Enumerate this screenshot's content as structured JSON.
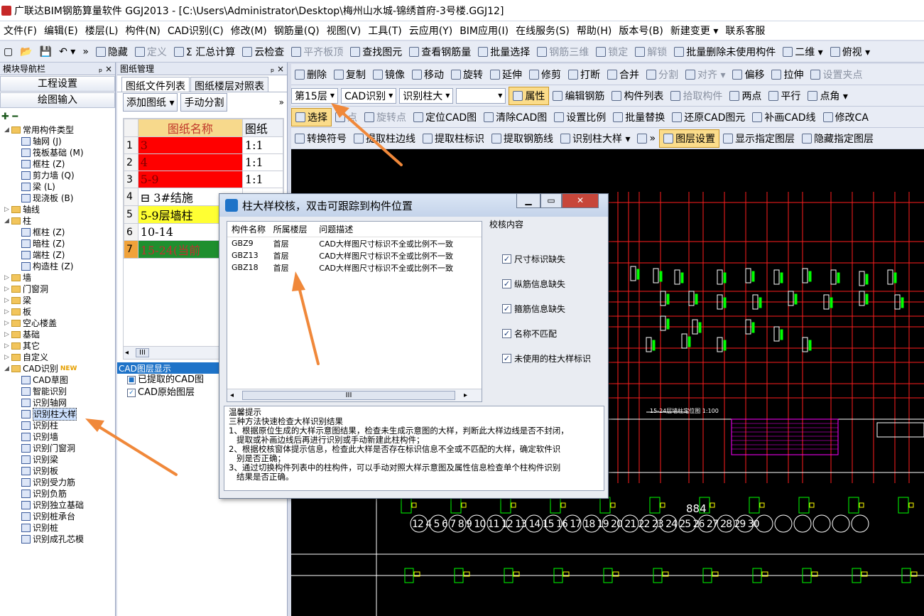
{
  "window": {
    "title": "广联达BIM钢筋算量软件 GGJ2013 - [C:\\Users\\Administrator\\Desktop\\梅州山水城-锦绣首府-3号楼.GGJ12]"
  },
  "menu": [
    "文件(F)",
    "编辑(E)",
    "楼层(L)",
    "构件(N)",
    "CAD识别(C)",
    "修改(M)",
    "钢筋量(Q)",
    "视图(V)",
    "工具(T)",
    "云应用(Y)",
    "BIM应用(I)",
    "在线服务(S)",
    "帮助(H)",
    "版本号(B)",
    "新建变更 ▾",
    "联系客服"
  ],
  "toolbar1": [
    {
      "label": "隐藏",
      "dis": false
    },
    {
      "label": "定义",
      "dis": true
    },
    {
      "label": "Σ 汇总计算",
      "dis": false
    },
    {
      "label": "云检查",
      "dis": false
    },
    {
      "label": "平齐板顶",
      "dis": true
    },
    {
      "label": "查找图元",
      "dis": false
    },
    {
      "label": "查看钢筋量",
      "dis": false
    },
    {
      "label": "批量选择",
      "dis": false
    },
    {
      "label": "钢筋三维",
      "dis": true
    },
    {
      "label": "锁定",
      "dis": true
    },
    {
      "label": "解锁",
      "dis": true
    },
    {
      "label": "批量删除未使用构件",
      "dis": false
    },
    {
      "label": "二维 ▾",
      "dis": false
    },
    {
      "label": "俯视 ▾",
      "dis": false
    }
  ],
  "nav": {
    "header": "模块导航栏",
    "pin": "ₚ",
    "close": "×",
    "btn_project": "工程设置",
    "btn_draw": "绘图输入",
    "tree": [
      {
        "t": "常用构件类型",
        "lvl": 0,
        "type": "folder",
        "open": true
      },
      {
        "t": "轴网 (J)",
        "lvl": 1,
        "type": "comp"
      },
      {
        "t": "筏板基础 (M)",
        "lvl": 1,
        "type": "comp"
      },
      {
        "t": "框柱 (Z)",
        "lvl": 1,
        "type": "comp"
      },
      {
        "t": "剪力墙 (Q)",
        "lvl": 1,
        "type": "comp"
      },
      {
        "t": "梁 (L)",
        "lvl": 1,
        "type": "comp"
      },
      {
        "t": "现浇板 (B)",
        "lvl": 1,
        "type": "comp"
      },
      {
        "t": "轴线",
        "lvl": 0,
        "type": "folder",
        "open": false
      },
      {
        "t": "柱",
        "lvl": 0,
        "type": "folder",
        "open": true
      },
      {
        "t": "框柱 (Z)",
        "lvl": 1,
        "type": "comp"
      },
      {
        "t": "暗柱 (Z)",
        "lvl": 1,
        "type": "comp"
      },
      {
        "t": "端柱 (Z)",
        "lvl": 1,
        "type": "comp"
      },
      {
        "t": "构造柱 (Z)",
        "lvl": 1,
        "type": "comp"
      },
      {
        "t": "墙",
        "lvl": 0,
        "type": "folder",
        "open": false
      },
      {
        "t": "门窗洞",
        "lvl": 0,
        "type": "folder",
        "open": false
      },
      {
        "t": "梁",
        "lvl": 0,
        "type": "folder",
        "open": false
      },
      {
        "t": "板",
        "lvl": 0,
        "type": "folder",
        "open": false
      },
      {
        "t": "空心楼盖",
        "lvl": 0,
        "type": "folder",
        "open": false
      },
      {
        "t": "基础",
        "lvl": 0,
        "type": "folder",
        "open": false
      },
      {
        "t": "其它",
        "lvl": 0,
        "type": "folder",
        "open": false
      },
      {
        "t": "自定义",
        "lvl": 0,
        "type": "folder",
        "open": false
      },
      {
        "t": "CAD识别",
        "lvl": 0,
        "type": "folder",
        "open": true,
        "new": "NEW"
      },
      {
        "t": "CAD草图",
        "lvl": 1,
        "type": "comp"
      },
      {
        "t": "智能识别",
        "lvl": 1,
        "type": "comp"
      },
      {
        "t": "识别轴网",
        "lvl": 1,
        "type": "comp"
      },
      {
        "t": "识别柱大样",
        "lvl": 1,
        "type": "comp",
        "sel": true
      },
      {
        "t": "识别柱",
        "lvl": 1,
        "type": "comp"
      },
      {
        "t": "识别墙",
        "lvl": 1,
        "type": "comp"
      },
      {
        "t": "识别门窗洞",
        "lvl": 1,
        "type": "comp"
      },
      {
        "t": "识别梁",
        "lvl": 1,
        "type": "comp"
      },
      {
        "t": "识别板",
        "lvl": 1,
        "type": "comp"
      },
      {
        "t": "识别受力筋",
        "lvl": 1,
        "type": "comp"
      },
      {
        "t": "识别负筋",
        "lvl": 1,
        "type": "comp"
      },
      {
        "t": "识别独立基础",
        "lvl": 1,
        "type": "comp"
      },
      {
        "t": "识别桩承台",
        "lvl": 1,
        "type": "comp"
      },
      {
        "t": "识别桩",
        "lvl": 1,
        "type": "comp"
      },
      {
        "t": "识别成孔芯模",
        "lvl": 1,
        "type": "comp"
      }
    ]
  },
  "drawings": {
    "header": "图纸管理",
    "tab1": "图纸文件列表",
    "tab2": "图纸楼层对照表",
    "btn_add": "添加图纸 ▾",
    "btn_split": "手动分割",
    "more": "»",
    "col_name": "图纸名称",
    "col_scale": "图纸",
    "rows": [
      {
        "n": "1",
        "name": "3",
        "scale": "1:1",
        "bg": "#ff0000"
      },
      {
        "n": "2",
        "name": "4",
        "scale": "1:1",
        "bg": "#ff0000"
      },
      {
        "n": "3",
        "name": "5-9",
        "scale": "1:1",
        "bg": "#ff0000"
      },
      {
        "n": "4",
        "name": "⊟ 3#结施",
        "scale": "",
        "bg": "#ffffff"
      },
      {
        "n": "5",
        "name": "5-9层墙柱",
        "scale": "",
        "bg": "#ffff33"
      },
      {
        "n": "6",
        "name": "10-14",
        "scale": "",
        "bg": "#ffffff"
      },
      {
        "n": "7",
        "name": "15-24(当前",
        "scale": "",
        "bg": "#1f8f2f"
      }
    ],
    "scroll_thumb": "III",
    "layer_header": "CAD图层显示",
    "layers": [
      "已提取的CAD图",
      "CAD原始图层"
    ]
  },
  "ribbon": {
    "row1": [
      "删除",
      "复制",
      "镜像",
      "移动",
      "旋转",
      "延伸",
      "修剪",
      "打断",
      "合并",
      "分割",
      "对齐 ▾",
      "偏移",
      "拉伸",
      "设置夹点"
    ],
    "row1_dis": [
      false,
      false,
      false,
      false,
      false,
      false,
      false,
      false,
      false,
      true,
      true,
      false,
      false,
      true
    ],
    "floor": "第15层",
    "cad_combo": "CAD识别",
    "col_combo": "识别柱大",
    "blank_combo": "",
    "row2": [
      "属性",
      "编辑钢筋",
      "构件列表",
      "拾取构件",
      "两点",
      "平行",
      "点角 ▾"
    ],
    "row3": [
      "选择",
      "点",
      "旋转点",
      "定位CAD图",
      "清除CAD图",
      "设置比例",
      "批量替换",
      "还原CAD图元",
      "补画CAD线",
      "修改CA"
    ],
    "row4": [
      "转换符号",
      "提取柱边线",
      "提取柱标识",
      "提取钢筋线",
      "识别柱大样 ▾",
      "»",
      "图层设置",
      "显示指定图层",
      "隐藏指定图层"
    ]
  },
  "dialog": {
    "title": "柱大样校核，双击可跟踪到构件位置",
    "min": "▁",
    "max": "▭",
    "close": "✕",
    "cols": [
      "构件名称",
      "所属楼层",
      "问题描述"
    ],
    "rows": [
      {
        "name": "GBZ9",
        "floor": "首层",
        "desc": "CAD大样图尺寸标识不全或比例不一致"
      },
      {
        "name": "GBZ13",
        "floor": "首层",
        "desc": "CAD大样图尺寸标识不全或比例不一致"
      },
      {
        "name": "GBZ18",
        "floor": "首层",
        "desc": "CAD大样图尺寸标识不全或比例不一致"
      }
    ],
    "scroll_thumb": "III",
    "check_title": "校核内容",
    "checks": [
      "尺寸标识缺失",
      "纵筋信息缺失",
      "箍筋信息缺失",
      "名称不匹配",
      "未使用的柱大样标识"
    ],
    "tips": [
      "温馨提示",
      "三种方法快速检查大样识别结果",
      "1、根据原位生成的大样示意图结果，检查未生成示意图的大样，判断此大样边线是否不封闭，",
      "   提取或补画边线后再进行识别或手动新建此柱构件；",
      "2、根据校核窗体提示信息，检查此大样是否存在标识信息不全或不匹配的大样，确定软件识",
      "   别是否正确；",
      "3、通过切换构件列表中的柱构件，可以手动对照大样示意图及属性信息检查单个柱构件识别",
      "   结果是否正确。"
    ]
  },
  "cad": {
    "label": "15-24层墙柱定位图",
    "scale": "1:100",
    "number": "884",
    "dims": "12 4 5 6 7 8 9 10 11 12 13 14 15 16 17 18 19 20 21 22 23 24 25 26 27 28 29 30"
  },
  "colors": {
    "arrow": "#f0883a",
    "cad_red": "#ff1e1e",
    "cad_green": "#00ff00",
    "cad_yellow": "#ffff00",
    "cad_magenta": "#ff00ff"
  }
}
